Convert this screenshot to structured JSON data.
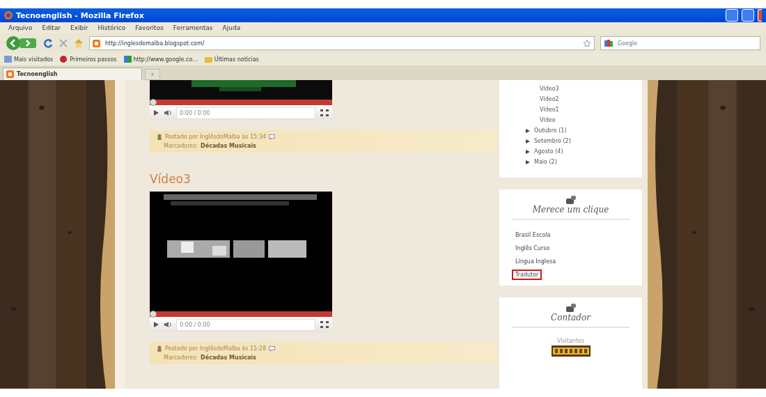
{
  "window": {
    "title": "Tecnoenglish - Mozilla Firefox"
  },
  "menu": [
    "Arquivo",
    "Editar",
    "Exibir",
    "Histórico",
    "Favoritos",
    "Ferramentas",
    "Ajuda"
  ],
  "address": {
    "value": "http://inglesdomalba.blogspot.com/"
  },
  "search": {
    "placeholder": "Google"
  },
  "bookmarks": [
    "Mais visitados",
    "Primeiros passos",
    "http://www.google.co...",
    "Últimas notícias"
  ],
  "tabs": [
    {
      "label": "Tecnoenglish",
      "selected": true
    }
  ],
  "new_tab": "+",
  "posts": [
    {
      "level": 0,
      "time": "0:00 / 0:00",
      "posted": "Postado por InglêsdoMalba às 15:34",
      "labels_caption": "Marcadores:",
      "labels": "Décadas Musicais"
    },
    {
      "title": "Vídeo3",
      "level": 0,
      "time": "0:00 / 0:00",
      "posted": "Postado por InglêsdoMalba às 15:28",
      "labels_caption": "Marcadores:",
      "labels": "Décadas Musicais"
    }
  ],
  "archive": {
    "posts": [
      "Vídeo3",
      "Vídeo2",
      "Vídeo1",
      "Vídeo"
    ],
    "months": [
      {
        "label": "Outubro (1)",
        "expanded": false
      },
      {
        "label": "Setembro (2)",
        "expanded": false
      },
      {
        "label": "Agosto (4)",
        "expanded": false
      },
      {
        "label": "Maio (2)",
        "expanded": false
      }
    ]
  },
  "links_widget": {
    "title": "Merece um clique",
    "links": [
      {
        "label": "Brasil Escola",
        "highlighted": false
      },
      {
        "label": "Inglês Curso",
        "highlighted": false
      },
      {
        "label": "Língua Inglesa",
        "highlighted": false
      },
      {
        "label": "Tradutor",
        "highlighted": true
      }
    ]
  },
  "counter_widget": {
    "title": "Contador",
    "caption": "Visitantes"
  }
}
